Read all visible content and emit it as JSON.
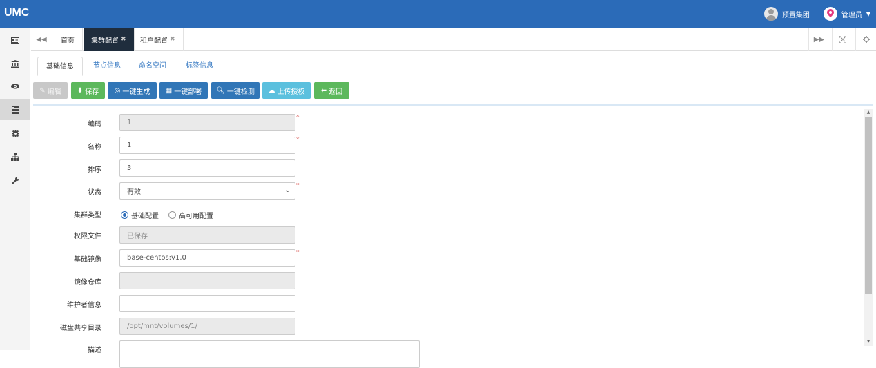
{
  "app": {
    "title": "UMC"
  },
  "user": {
    "group": "预置集团",
    "name": "管理员"
  },
  "sidebar": {
    "items": [
      "id-card-icon",
      "bank-icon",
      "eye-icon",
      "server-icon",
      "gear-icon",
      "sitemap-icon",
      "wrench-icon"
    ],
    "active": 3
  },
  "tabs": {
    "items": [
      {
        "label": "首页",
        "closable": false
      },
      {
        "label": "集群配置",
        "closable": true
      },
      {
        "label": "租户配置",
        "closable": true
      }
    ],
    "active": 1,
    "close_glyph": "✖"
  },
  "subtabs": {
    "items": [
      "基础信息",
      "节点信息",
      "命名空间",
      "标签信息"
    ],
    "active": 0
  },
  "toolbar": {
    "edit": "编辑",
    "save": "保存",
    "generate": "一键生成",
    "deploy": "一键部署",
    "check": "一键检测",
    "upload": "上传授权",
    "back": "返回"
  },
  "form": {
    "code_label": "编码",
    "code_value": "1",
    "name_label": "名称",
    "name_value": "1",
    "order_label": "排序",
    "order_value": "3",
    "status_label": "状态",
    "status_value": "有效",
    "cluster_type_label": "集群类型",
    "cluster_type_options": [
      "基础配置",
      "高可用配置"
    ],
    "cluster_type_selected": "基础配置",
    "license_label": "权限文件",
    "license_value": "已保存",
    "base_image_label": "基础镜像",
    "base_image_value": "base-centos:v1.0",
    "registry_label": "镜像仓库",
    "registry_value": "",
    "maintainer_label": "维护者信息",
    "maintainer_value": "",
    "disk_dir_label": "磁盘共享目录",
    "disk_dir_value": "/opt/mnt/volumes/1/",
    "desc_label": "描述",
    "required_mark": "*"
  }
}
